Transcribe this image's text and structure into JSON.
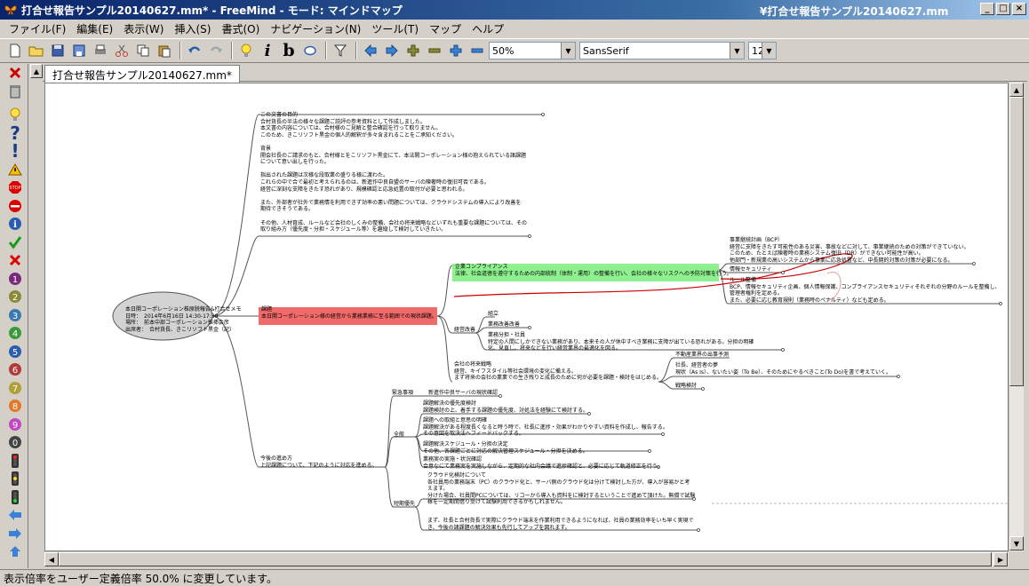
{
  "window": {
    "title": "打合せ報告サンプル20140627.mm* - FreeMind - モード: マインドマップ",
    "path_suffix": "¥打合せ報告サンプル20140627.mm",
    "minimize": "_",
    "maximize": "□",
    "close": "×"
  },
  "menu": [
    "ファイル(F)",
    "編集(E)",
    "表示(W)",
    "挿入(S)",
    "書式(O)",
    "ナビゲーション(N)",
    "ツール(T)",
    "マップ",
    "ヘルプ"
  ],
  "toolbar": {
    "zoom": "50%",
    "font": "SansSerif",
    "font_size": "12",
    "bold_label": "b",
    "italic_label": "i"
  },
  "tab": {
    "label": "打合せ報告サンプル20140627.mm*"
  },
  "status": {
    "text": "表示倍率をユーザー定義倍率 50.0% に変更しています。"
  },
  "colors": {
    "root_fill": "#d3d3d3",
    "issue_fill": "#f26b6b",
    "compliance_fill": "#8ff08f",
    "cloud_outline": "#cc0000"
  },
  "mindmap": {
    "root": [
      "本日開コーポレーション株原脱報告&打合せメモ",
      "日時：　2014年6月16日 14:30-17:30",
      "場所：　前本中部コーポレーション推挿会彦",
      "出席者：　合村貨長、きこリソフト黒金（記）"
    ],
    "top_block": [
      "この文書の目的",
      "合村貨長の半法の様々な課題ご説評の参考資料として作成しました。",
      "本文書の内容については、合村様のご見解と整合確認を行って取りません。",
      "このため、きこリソフト黒金の個人的解釈が多々含まれることをご承知ください。",
      "",
      "背景",
      "開会社長のご請求のもと、合村様とをこリソフト黒金にて、本法開コーポレーション様の抱えられている諸課題",
      "について意い出しを行った。",
      "",
      "指出された課題は次様な段取業の盛りる様に渡わた。",
      "これらの中で合で最初と考えられるのは、新進作中良自盟のサーバの陳奢時の復旧可否である。",
      "経営に深刻な支障をきたす恐れがあり、規模確認と応急処置の取付が必要と思われる。",
      "",
      "また、外部者が社外で業務情を利用できず効率の悪い問題については、クラウドシステムの導入により改善を",
      "期待できそうである。",
      "",
      "その他、人材育成、ルールなど会社のしくみの整備、会社の将来戦略などいずれも重要な課題については、その",
      "取り組み方（優先度・分担・スケジュール等）を趣縦して検討していきたい。"
    ],
    "issue": [
      "課題",
      "本日開コーポレーション様の経営から業務業務に至る範囲での現状課題。"
    ],
    "compliance": [
      "企業コンプライアンス",
      "法律、社会道徳を遵守するための内部統制（体制・運用）の整備を行い、会社の様々なリスクへの予防対策を行う。"
    ],
    "bcp": [
      "事業継続計画（BCP）",
      "経営に支障をきたす可能性のある災害、事故などに対して、事業継続のための対策ができていない。",
      "このため、たとえば陳奢時の業務システム復旧（DR）ができない可能性が高い。",
      "他部門・新規業の高いシステムから事業に応急処置など、中長期的対策の対策が必要になる。"
    ],
    "info_security": "情報セキュリティ",
    "rules": [
      "ルール整備",
      "BCP、情報セキュリティ企画、個人情報保護、コンプライアンスセキュリティそれぞれの分野のルールを整備し、",
      "管理者権利を定める。",
      "また、必要に応じ教育規則（業務時のペナルティ）なども定める。"
    ],
    "management": "経営改善",
    "org_design": "組立",
    "business_improvement": "業務改善改善",
    "hr_training": [
      "業務分担・社員",
      "特定の人間にしかできない業務があり、本来その人が休中すべき業務に支障が出ている恐れがある。分担の明確",
      "化、見直し、将来などを行い経営業界の最適化を図る。"
    ],
    "future_strategy": [
      "会社の将来戦略",
      "経営、キイフスタイル等社会環境の変化に備える。",
      "まず将来の会社の業業での生き残りと成長のために何が必要を課題・検討をはじめる。"
    ],
    "real_estate": "不動産業界の出事予測",
    "customers": [
      "社長、経営者の夢",
      "現状（As Is）、ないたい姿（To Be）、そのためにやるべきこと(To Do)を書で考えていく。"
    ],
    "strategy_review": "戦略検討",
    "approach": [
      "今後の進め方",
      "上記課題について、下記のように対応を進める。"
    ],
    "urgent": "緊急事項",
    "urgent_item": "新進作中良サーバの現状確認",
    "policy": "全般",
    "policy_items": [
      [
        "課題解決の優先度検討",
        "課題検討の上、着手する課題の優先度、対処法を経験にて検討する。"
      ],
      [
        "課題への取組と意思の明確",
        "課題解決がある程度長くなると時う時で、社長に進捗・効果がわかりやすい資料を作成し、報告する。",
        "その意図を取決法へフィードバックする。"
      ],
      [
        "課題解決スケジュール・分担の決定",
        "その他、各課題ごとに対応の解決管理スケジュール・分担を決める。"
      ],
      [
        "業務実の実施・状況確認",
        "合意なにて業務実を実施しながら、定期的な社内会議で進捗確認と、必要に応じて軌道修正を行う。"
      ]
    ],
    "shortterm": "短期優先",
    "shortterm_items": [
      [
        "クラウド化検討について",
        "各社員用の業務端末（PC）のクラウド化と、サーバ側のクラウド化は分けて検討した方が、導入が容易かと考",
        "えます。",
        "分けた場合、社員間PCについては、リコーから導入も資料をに検討するということで進めて頂けた。無償で試験",
        "稼を一定期間借り受けて試験利用できるかもしれません。"
      ],
      [
        "まず、社長と合村貨長で実際にクラウド端末を作業利用できるようになれば、社員の業務効率をいち早く実現で",
        "き、今後の諸課題の解決効果も先行してアップを図れます。"
      ]
    ]
  }
}
